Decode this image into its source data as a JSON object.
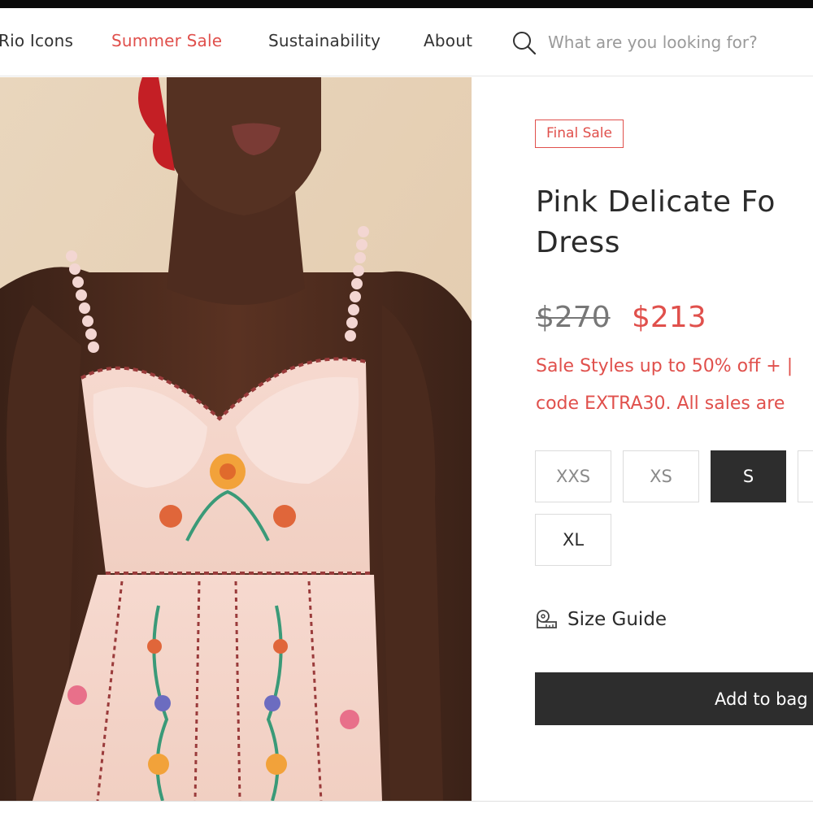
{
  "nav": {
    "items": [
      {
        "label": "Rio Icons"
      },
      {
        "label": "Summer Sale"
      },
      {
        "label": "Sustainability"
      },
      {
        "label": "About"
      }
    ],
    "search": {
      "placeholder": "What are you looking for?"
    }
  },
  "product": {
    "badge": "Final Sale",
    "title_line1": "Pink Delicate Fo",
    "title_line2": "Dress",
    "price_original": "$270",
    "price_sale": "$213",
    "promo_line1": "Sale Styles up to 50% off + |",
    "promo_line2": "code EXTRA30. All sales are",
    "sizes": [
      {
        "label": "XXS",
        "selected": false
      },
      {
        "label": "XS",
        "selected": false
      },
      {
        "label": "S",
        "selected": true
      },
      {
        "label": "",
        "selected": false
      },
      {
        "label": "XL",
        "selected": false
      }
    ],
    "size_guide": "Size Guide",
    "add_to_bag": "Add to bag"
  },
  "colors": {
    "accent": "#e0504c",
    "dark_button": "#2d2d2d",
    "text": "#2b2b2b"
  },
  "icons": {
    "search": "search-icon",
    "size_guide": "ruler-icon"
  }
}
